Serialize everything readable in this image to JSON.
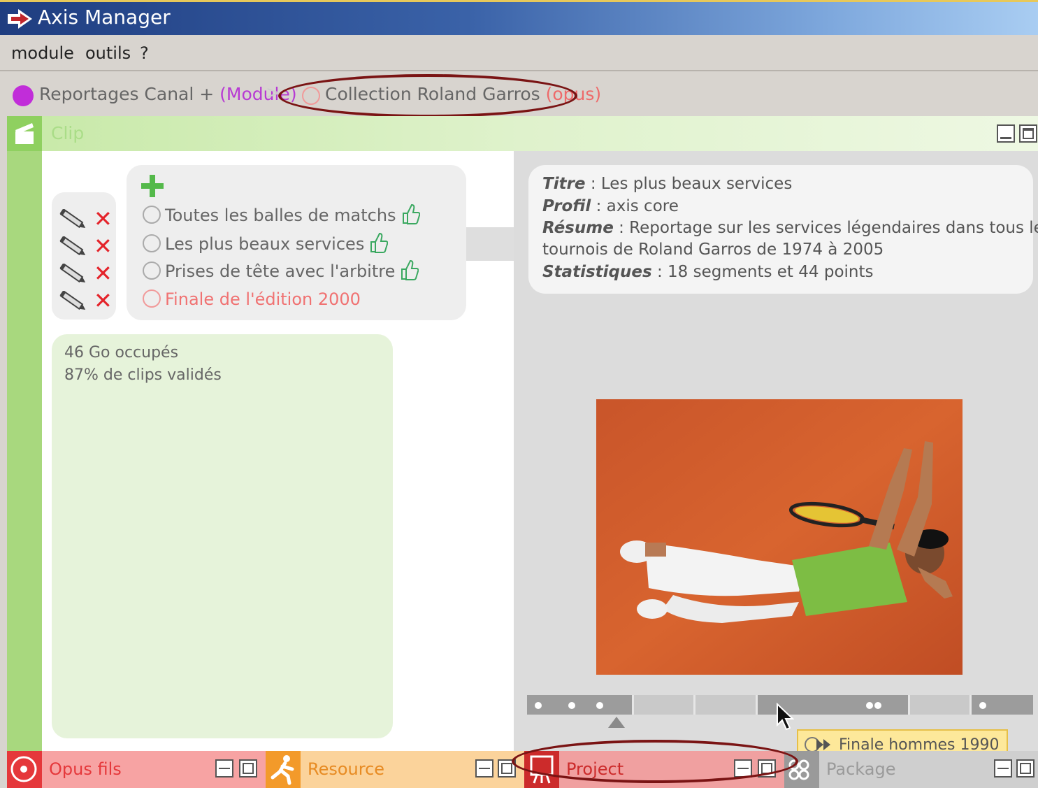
{
  "window": {
    "title": "Axis Manager"
  },
  "menu": {
    "items": [
      "module",
      "outils",
      "?"
    ]
  },
  "breadcrumb": {
    "module_name": "Reportages Canal +",
    "module_type": "(Module)",
    "separator": ">",
    "opus_name": "Collection Roland Garros",
    "opus_type": "(opus)"
  },
  "panel": {
    "title": "Clip"
  },
  "clips": [
    {
      "label": "Toutes les balles de matchs",
      "approved": true
    },
    {
      "label": "Les plus beaux services",
      "approved": true,
      "selected": true
    },
    {
      "label": "Prises de tête avec l'arbitre",
      "approved": true
    },
    {
      "label": "Finale de l'édition 2000",
      "approved": false,
      "highlight": true
    }
  ],
  "stats": {
    "storage": "46 Go occupés",
    "validated": "87% de clips validés"
  },
  "details": {
    "titre_label": "Titre",
    "titre_value": "Les plus beaux services",
    "profil_label": "Profil",
    "profil_value": "axis core",
    "resume_label": "Résume",
    "resume_value_1": "Reportage sur les services légendaires dans tous les",
    "resume_value_2": "tournois de Roland Garros de 1974 à 2005",
    "stats_label": "Statistiques",
    "stats_value": "18 segments et 44 points"
  },
  "tooltip": {
    "text": "Finale hommes 1990"
  },
  "bottom_tabs": [
    {
      "label": "Opus fils",
      "color": "#f7a3a3",
      "icon_color": "#e5383b"
    },
    {
      "label": "Resource",
      "color": "#fbd39b",
      "icon_color": "#f39a2a"
    },
    {
      "label": "Project",
      "color": "#f0a0a0",
      "icon_color": "#cc2b2b"
    },
    {
      "label": "Package",
      "color": "#cfcfcf",
      "icon_color": "#9a9a9a"
    }
  ],
  "colors": {
    "module": "#c12dd9",
    "opus": "#ee6a6a",
    "clip_accent": "#8fd060",
    "delete": "#e4232a"
  }
}
